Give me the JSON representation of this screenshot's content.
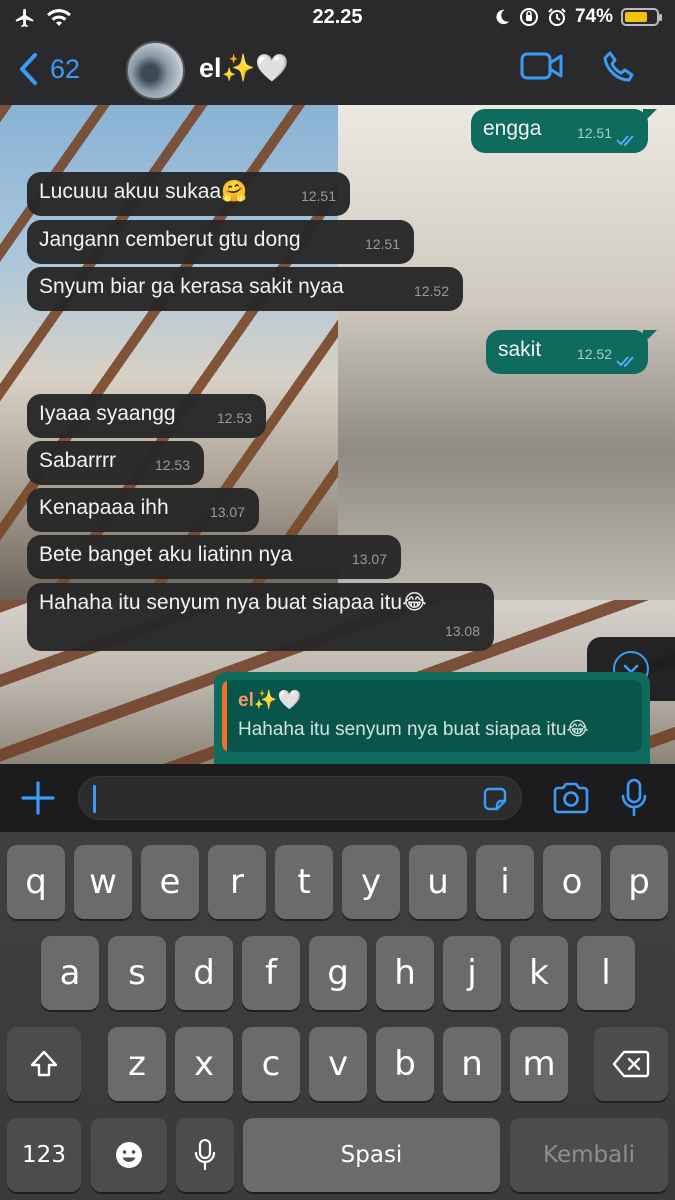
{
  "status_bar": {
    "time": "22.25",
    "battery": "74%",
    "battery_level": 0.74
  },
  "header": {
    "back_count": "62",
    "contact_name": "el✨🤍"
  },
  "messages": [
    {
      "dir": "out",
      "text": "engga",
      "time": "12.51"
    },
    {
      "dir": "in",
      "text": "Lucuuu akuu sukaa🤗",
      "time": "12.51"
    },
    {
      "dir": "in",
      "text": "Jangann cemberut gtu dong",
      "time": "12.51"
    },
    {
      "dir": "in",
      "text": "Snyum biar ga kerasa sakit nyaa",
      "time": "12.52"
    },
    {
      "dir": "out",
      "text": "sakit",
      "time": "12.52"
    },
    {
      "dir": "in",
      "text": "Iyaaa syaangg",
      "time": "12.53"
    },
    {
      "dir": "in",
      "text": "Sabarrrr",
      "time": "12.53"
    },
    {
      "dir": "in",
      "text": "Kenapaaa ihh",
      "time": "13.07"
    },
    {
      "dir": "in",
      "text": "Bete banget aku liatinn nya",
      "time": "13.07"
    },
    {
      "dir": "in",
      "text": "Hahaha itu senyum nya buat siapaa itu😂",
      "time": "13.08"
    }
  ],
  "reply_preview": {
    "author": "el✨🤍",
    "text": "Hahaha itu senyum nya buat siapaa itu😂"
  },
  "keyboard": {
    "row1": [
      "q",
      "w",
      "e",
      "r",
      "t",
      "y",
      "u",
      "i",
      "o",
      "p"
    ],
    "row2": [
      "a",
      "s",
      "d",
      "f",
      "g",
      "h",
      "j",
      "k",
      "l"
    ],
    "row3": [
      "z",
      "x",
      "c",
      "v",
      "b",
      "n",
      "m"
    ],
    "numbers": "123",
    "space": "Spasi",
    "return": "Kembali"
  },
  "colors": {
    "accent": "#3b9cf7",
    "outgoing_bubble": "#0f6b5e",
    "incoming_bubble": "#262628",
    "reply_bar": "#f0722a"
  }
}
